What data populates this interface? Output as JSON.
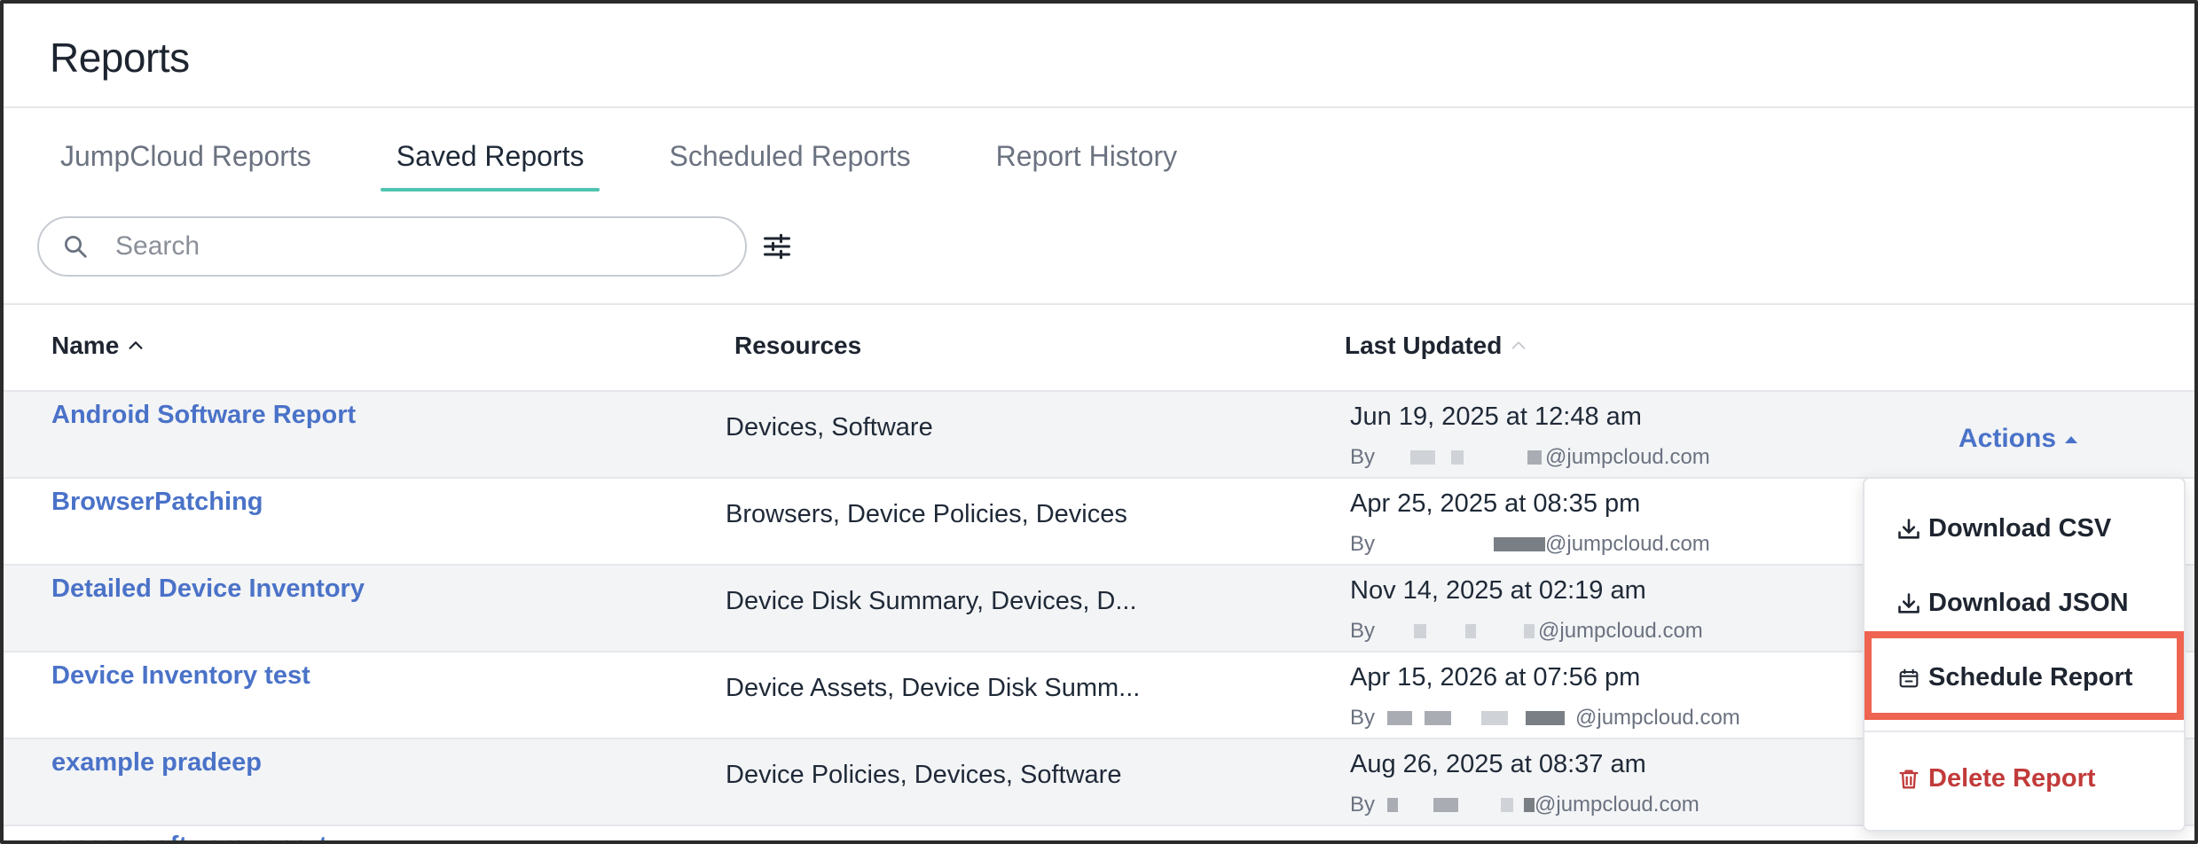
{
  "page": {
    "title": "Reports"
  },
  "tabs": [
    {
      "label": "JumpCloud Reports",
      "active": false
    },
    {
      "label": "Saved Reports",
      "active": true
    },
    {
      "label": "Scheduled Reports",
      "active": false
    },
    {
      "label": "Report History",
      "active": false
    }
  ],
  "search": {
    "placeholder": "Search",
    "value": ""
  },
  "table": {
    "columns": {
      "name": "Name",
      "resources": "Resources",
      "last_updated": "Last Updated"
    },
    "rows": [
      {
        "name": "Android Software Report",
        "resources": "Devices, Software",
        "date": "Jun 19, 2025 at 12:48 am",
        "by": "By",
        "email_domain": "@jumpcloud.com"
      },
      {
        "name": "BrowserPatching",
        "resources": "Browsers, Device Policies, Devices",
        "date": "Apr 25, 2025 at 08:35 pm",
        "by": "By",
        "email_domain": "@jumpcloud.com"
      },
      {
        "name": "Detailed Device Inventory",
        "resources": "Device Disk Summary, Devices, D...",
        "date": "Nov 14, 2025 at 02:19 am",
        "by": "By",
        "email_domain": "@jumpcloud.com"
      },
      {
        "name": "Device Inventory test",
        "resources": "Device Assets, Device Disk Summ...",
        "date": "Apr 15, 2026 at 07:56 pm",
        "by": "By",
        "email_domain": "@jumpcloud.com"
      },
      {
        "name": "example pradeep",
        "resources": "Device Policies, Devices, Software",
        "date": "Aug 26, 2025 at 08:37 am",
        "by": "By",
        "email_domain": "@jumpcloud.com"
      }
    ],
    "partial_row_name": "macos software report"
  },
  "actions": {
    "label": "Actions",
    "menu": {
      "download_csv": "Download CSV",
      "download_json": "Download JSON",
      "schedule_report": "Schedule Report",
      "delete_report": "Delete Report"
    }
  },
  "colors": {
    "link": "#4a72c8",
    "tab_underline": "#4fc4b0",
    "highlight_box": "#ee6451",
    "danger": "#c23a3a"
  },
  "icons": [
    "search-icon",
    "filter-settings-icon",
    "sort-up-icon",
    "caret-up-icon",
    "download-icon",
    "calendar-icon",
    "trash-icon"
  ]
}
